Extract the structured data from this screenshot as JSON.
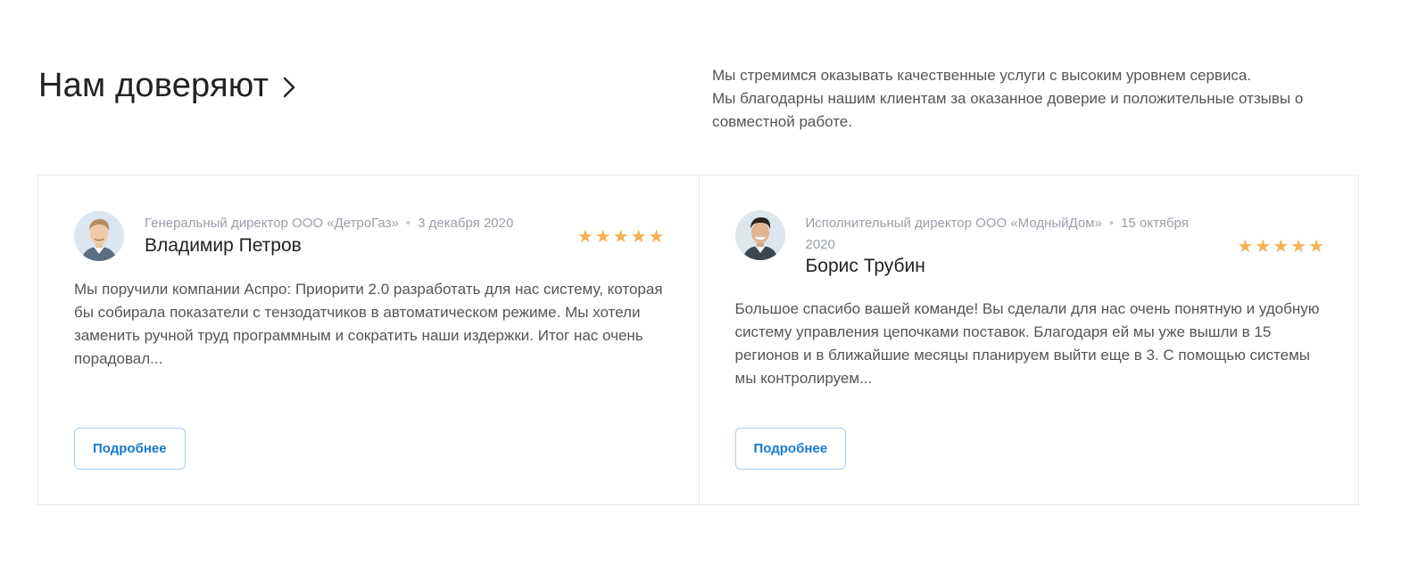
{
  "section": {
    "title": "Нам доверяют",
    "intro_lines": [
      "Мы стремимся оказывать качественные услуги с высоким уровнем сервиса.",
      "Мы благодарны нашим клиентам за оказанное доверие и положительные отзывы о совместной работе."
    ]
  },
  "reviews": [
    {
      "position": "Генеральный директор ООО «ДетроГаз»",
      "date": "3 декабря 2020",
      "name": "Владимир Петров",
      "rating": 5,
      "text": "Мы поручили компании Аспро: Приорити 2.0 разработать для нас систему, которая бы собирала показатели с тензодатчиков в автоматическом режиме. Мы хотели заменить ручной труд программным и сократить наши издержки. Итог нас очень порадовал...",
      "button_label": "Подробнее"
    },
    {
      "position": "Исполнительный директор ООО «МодныйДом»",
      "date": "15 октября 2020",
      "name": "Борис Трубин",
      "rating": 5,
      "text": "Большое спасибо вашей команде! Вы сделали для нас очень понятную и удобную систему управления цепочками поставок. Благодаря ей мы уже вышли в 15 регионов и в ближайшие месяцы планируем выйти еще в 3. С помощью системы мы контролируем...",
      "button_label": "Подробнее"
    }
  ],
  "colors": {
    "accent": "#1779d4",
    "star": "#f6b150",
    "border": "#e6e9ee",
    "muted": "#999fa8"
  },
  "icons": {
    "header_arrow": "chevron-right-icon",
    "rating": "star-icon"
  }
}
